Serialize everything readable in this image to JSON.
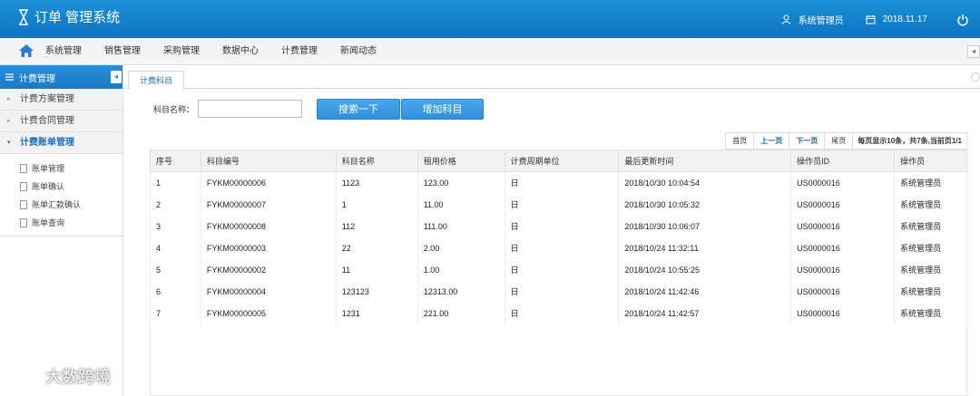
{
  "app": {
    "title": "订单 管理系统"
  },
  "topbar": {
    "user": "系统管理员",
    "date": "2018.11.17"
  },
  "nav": {
    "items": [
      "系统管理",
      "销售管理",
      "采购管理",
      "数据中心",
      "计费管理",
      "新闻动态"
    ]
  },
  "sidebar": {
    "header": "计费管理",
    "groups": [
      {
        "label": "计费方案管理"
      },
      {
        "label": "计费合同管理"
      },
      {
        "label": "计费账单管理"
      }
    ],
    "subitems": [
      "账单管理",
      "账单确认",
      "账单汇款确认",
      "账单查询"
    ]
  },
  "tab": {
    "label": "计费科目"
  },
  "search": {
    "label": "科目名称：",
    "value": "",
    "search_button": "搜索一下",
    "add_button": "增加科目"
  },
  "pager": {
    "first": "首页",
    "prev": "上一页",
    "next": "下一页",
    "last": "尾页",
    "info": "每页显示10条，共7条,当前页1/1"
  },
  "table": {
    "headers": [
      "序号",
      "科目编号",
      "科目名称",
      "租用价格",
      "计费周期单位",
      "最后更新时间",
      "操作员ID",
      "操作员"
    ],
    "rows": [
      [
        "1",
        "FYKM00000006",
        "1123",
        "123.00",
        "日",
        "2018/10/30 10:04:54",
        "US0000016",
        "系统管理员"
      ],
      [
        "2",
        "FYKM00000007",
        "1",
        "11.00",
        "日",
        "2018/10/30 10:05:32",
        "US0000016",
        "系统管理员"
      ],
      [
        "3",
        "FYKM00000008",
        "112",
        "111.00",
        "日",
        "2018/10/30 10:06:07",
        "US0000016",
        "系统管理员"
      ],
      [
        "4",
        "FYKM00000003",
        "22",
        "2.00",
        "日",
        "2018/10/24 11:32:11",
        "US0000016",
        "系统管理员"
      ],
      [
        "5",
        "FYKM00000002",
        "11",
        "1.00",
        "日",
        "2018/10/24 10:55:25",
        "US0000016",
        "系统管理员"
      ],
      [
        "6",
        "FYKM00000004",
        "123123",
        "12313.00",
        "日",
        "2018/10/24 11:42:46",
        "US0000016",
        "系统管理员"
      ],
      [
        "7",
        "FYKM00000005",
        "1231",
        "221.00",
        "日",
        "2018/10/24 11:42:57",
        "US0000016",
        "系统管理员"
      ]
    ]
  },
  "watermark": {
    "text": "大数跨境"
  }
}
